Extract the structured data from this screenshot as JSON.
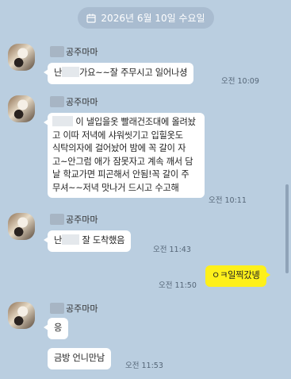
{
  "date_divider": "2026년 6월 10일 수요일",
  "sender_name": "공주마마",
  "messages": [
    {
      "from": "them",
      "lines": [
        "난",
        "가요~~잘 주무시고 일어나셩"
      ],
      "time": "오전 10:09"
    },
    {
      "from": "them",
      "lines": [
        "이 낼입을옷 빨래건조대에 올려놨",
        "고 이따 저녁에 샤워씻기고 입힐옷도",
        "식탁의자에 걸어놨어 밤에 꼭 갈이 자",
        "고~안그럼 애가 잠못자고 계속 깨서 담",
        "날 학교가면 피곤해서 안됨!꼭 갈이 주",
        "무셔~~저녁 맛나거 드시고 수고해"
      ],
      "time": "오전 10:11"
    },
    {
      "from": "them",
      "lines": [
        "난",
        "잘 도착했음"
      ],
      "time": "오전 11:43"
    },
    {
      "from": "me",
      "lines": [
        "ㅇㅋ일찍갔녱"
      ],
      "time": "오전 11:50"
    },
    {
      "from": "them",
      "lines": [
        "응"
      ],
      "time": ""
    },
    {
      "from": "them",
      "lines": [
        "금방 언니만남"
      ],
      "time": "오전 11:53"
    }
  ]
}
